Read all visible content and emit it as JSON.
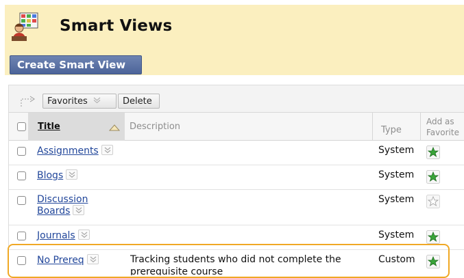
{
  "header": {
    "title": "Smart Views",
    "icon": "smart-views-icon",
    "create_button": "Create Smart View",
    "background": "#fbefbf"
  },
  "toolbar": {
    "favorites_label": "Favorites",
    "delete_label": "Delete"
  },
  "columns": {
    "title": "Title",
    "description": "Description",
    "type": "Type",
    "add_as_favorite_line1": "Add as",
    "add_as_favorite_line2": "Favorite"
  },
  "rows": [
    {
      "title": "Assignments",
      "description": "",
      "type": "System",
      "favorite": true
    },
    {
      "title_line1": "Blogs",
      "description": "",
      "type": "System",
      "favorite": true
    },
    {
      "title_line1": "Discussion",
      "title_line2": "Boards",
      "description": "",
      "type": "System",
      "favorite": false
    },
    {
      "title": "Journals",
      "description": "",
      "type": "System",
      "favorite": true
    },
    {
      "title": "No Prereq",
      "description_line1": "Tracking students who did not complete the",
      "description_line2": "prerequisite course",
      "type": "Custom",
      "favorite": true
    }
  ],
  "colors": {
    "link": "#21469a",
    "button": "#4c6499",
    "highlight": "#f0a824",
    "star_active": "#3aa53a"
  }
}
